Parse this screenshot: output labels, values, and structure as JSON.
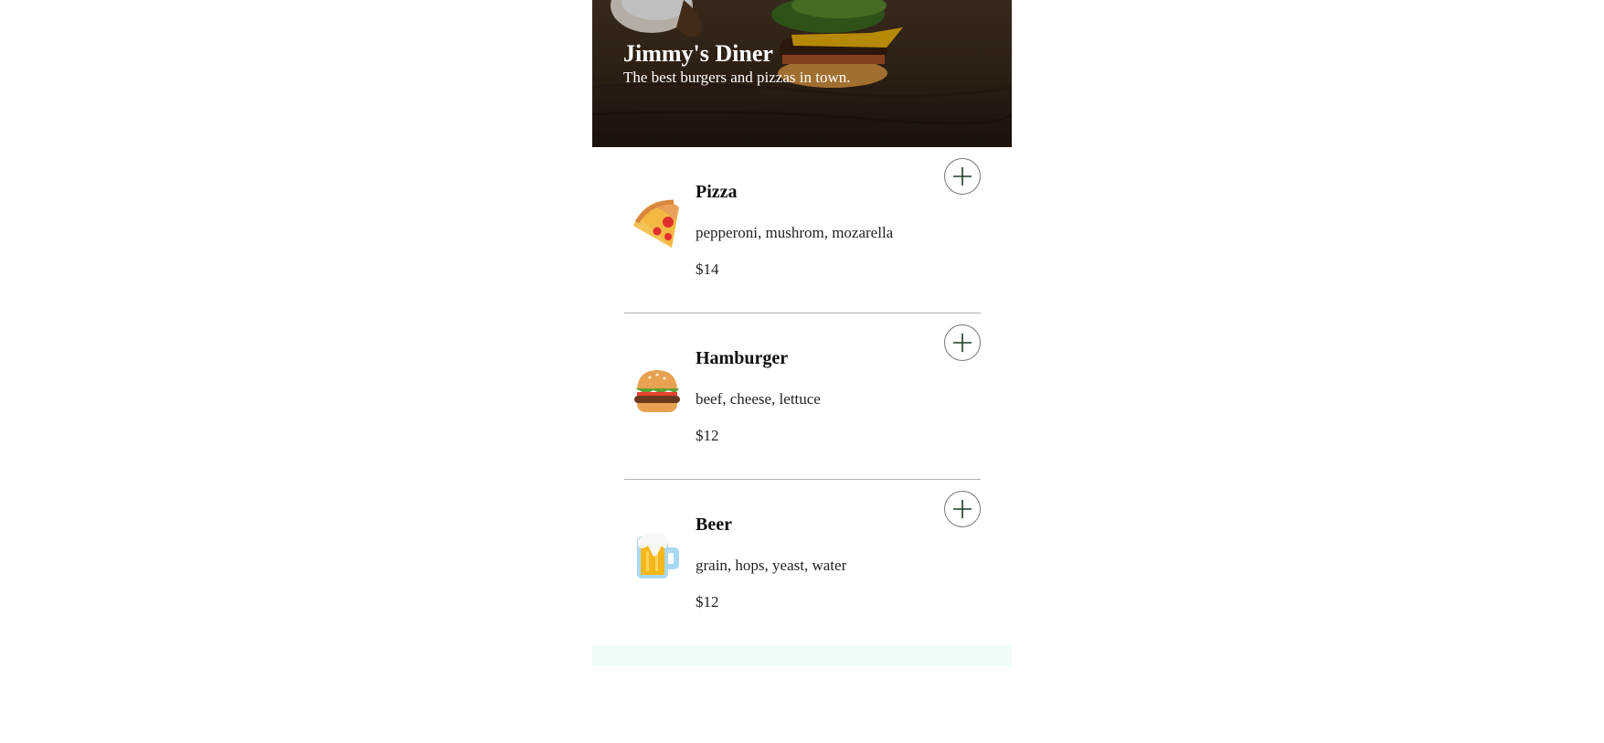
{
  "header": {
    "title": "Jimmy's Diner",
    "subtitle": "The best burgers and pizzas in town."
  },
  "menu": {
    "items": [
      {
        "name": "Pizza",
        "ingredients": "pepperoni, mushrom, mozarella",
        "price": "$14",
        "icon": "pizza-icon"
      },
      {
        "name": "Hamburger",
        "ingredients": "beef, cheese, lettuce",
        "price": "$12",
        "icon": "hamburger-icon"
      },
      {
        "name": "Beer",
        "ingredients": "grain, hops, yeast, water",
        "price": "$12",
        "icon": "beer-icon"
      }
    ],
    "add_button_icon": "plus-icon"
  },
  "colors": {
    "hero_background": "#2b1e14",
    "footer_strip": "#eefdf6",
    "divider": "#b0b0b0"
  }
}
